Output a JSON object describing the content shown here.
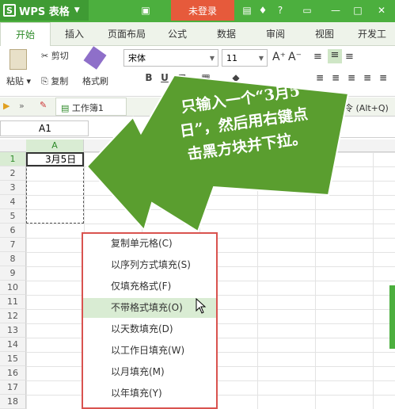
{
  "app": {
    "name": "WPS 表格",
    "login": "未登录"
  },
  "tabs": [
    "开始",
    "插入",
    "页面布局",
    "公式",
    "数据",
    "审阅",
    "视图",
    "开发工"
  ],
  "ribbon": {
    "paste": "粘贴",
    "cut": "剪切",
    "copy": "复制",
    "format_painter": "格式刷",
    "font": "宋体",
    "size": "11"
  },
  "toolbar2": {
    "workbook": "工作簿1",
    "command": "命令 (Alt+Q)"
  },
  "formula": {
    "cell_ref": "A1"
  },
  "sheet": {
    "col_a": "A",
    "rows": [
      "1",
      "2",
      "3",
      "4",
      "5",
      "6",
      "7",
      "8",
      "9",
      "10",
      "11",
      "12",
      "13",
      "14",
      "15",
      "16",
      "17",
      "18"
    ],
    "a1_value": "3月5日"
  },
  "context_menu": {
    "items": [
      "复制单元格(C)",
      "以序列方式填充(S)",
      "仅填充格式(F)",
      "不带格式填充(O)",
      "以天数填充(D)",
      "以工作日填充(W)",
      "以月填充(M)",
      "以年填充(Y)"
    ],
    "highlighted_index": 3
  },
  "callout": {
    "line1": "只输入一个“3月5",
    "line2": "日”，然后用右键点",
    "line3": "击黑方块并下拉。",
    "color": "#5a9e2f"
  },
  "colors": {
    "brand": "#4caf3e",
    "login": "#e65a3b",
    "menu_border": "#d9534f",
    "highlight": "#d9ecd3"
  }
}
